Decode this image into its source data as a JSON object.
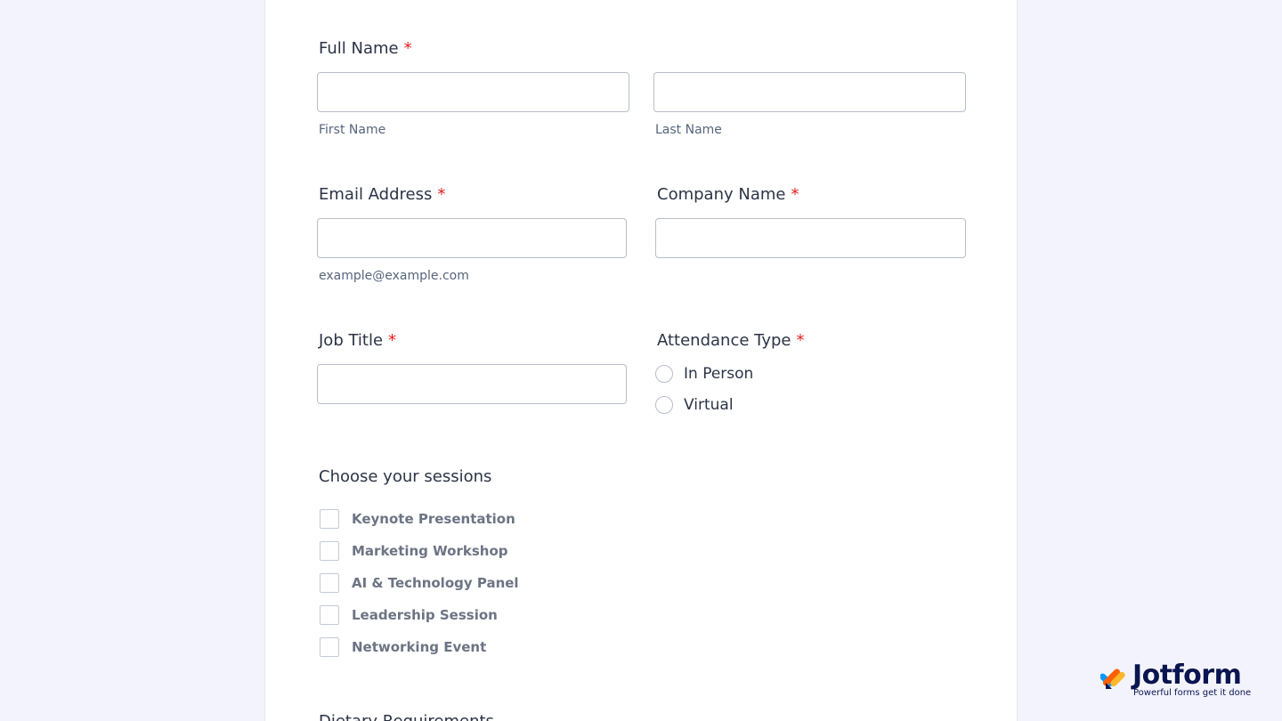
{
  "form": {
    "full_name": {
      "label": "Full Name",
      "required_mark": "*",
      "first": {
        "value": "",
        "sublabel": "First Name"
      },
      "last": {
        "value": "",
        "sublabel": "Last Name"
      }
    },
    "email": {
      "label": "Email Address",
      "required_mark": "*",
      "value": "",
      "sublabel": "example@example.com"
    },
    "company": {
      "label": "Company Name",
      "required_mark": "*",
      "value": ""
    },
    "job_title": {
      "label": "Job Title",
      "required_mark": "*",
      "value": ""
    },
    "attendance": {
      "label": "Attendance Type",
      "required_mark": "*",
      "options": [
        "In Person",
        "Virtual"
      ],
      "selected": null
    },
    "sessions": {
      "label": "Choose your sessions",
      "options": [
        "Keynote Presentation",
        "Marketing Workshop",
        "AI & Technology Panel",
        "Leadership Session",
        "Networking Event"
      ],
      "checked": []
    },
    "next_field_partial_label": "Dietary Requirements"
  },
  "branding": {
    "name": "Jotform",
    "tagline": "Powerful forms get it done",
    "logo_colors": [
      "#0099ff",
      "#ff6100",
      "#ffb629",
      "#0a1551"
    ]
  },
  "colors": {
    "page_background": "#f3f3fe",
    "required": "#e21d1d",
    "label": "#2c3345"
  }
}
